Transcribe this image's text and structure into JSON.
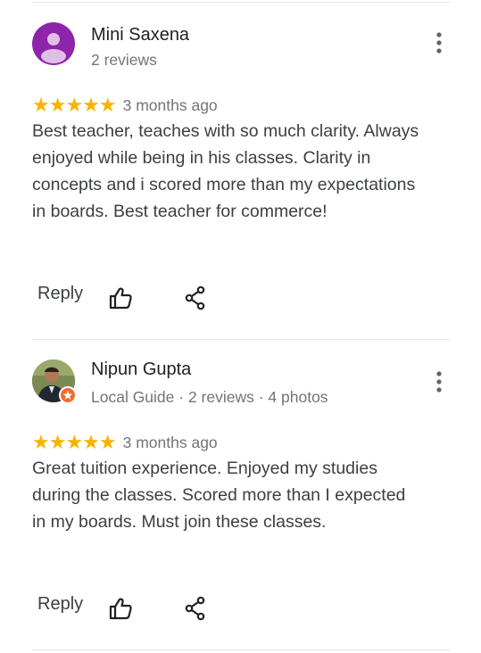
{
  "reviews": [
    {
      "name": "Mini Saxena",
      "meta": "2 reviews",
      "avatar_icon": "person-silhouette-icon",
      "avatar_color": "#8e24aa",
      "stars": "★★★★★",
      "rating": 5,
      "time": "3 months ago",
      "text": "Best teacher, teaches with so much clarity. Always enjoyed while being in his classes. Clarity in concepts and i scored more than my expectations in boards. Best teacher for commerce!",
      "reply_label": "Reply"
    },
    {
      "name": "Nipun Gupta",
      "meta": "Local Guide · 2 reviews · 4 photos",
      "avatar_icon": "profile-photo",
      "badge_icon": "local-guide-badge-icon",
      "stars": "★★★★★",
      "rating": 5,
      "time": "3 months ago",
      "text": "Great tuition experience. Enjoyed my studies during the classes. Scored more than I expected in my boards. Must join these classes.",
      "reply_label": "Reply"
    }
  ],
  "colors": {
    "star": "#f5b400",
    "secondary_text": "#70757a",
    "body_text": "#3c4043",
    "local_guide_badge": "#f06b2a"
  },
  "icons": {
    "more": "more-vert-icon",
    "like": "thumb-up-icon",
    "share": "share-icon"
  }
}
